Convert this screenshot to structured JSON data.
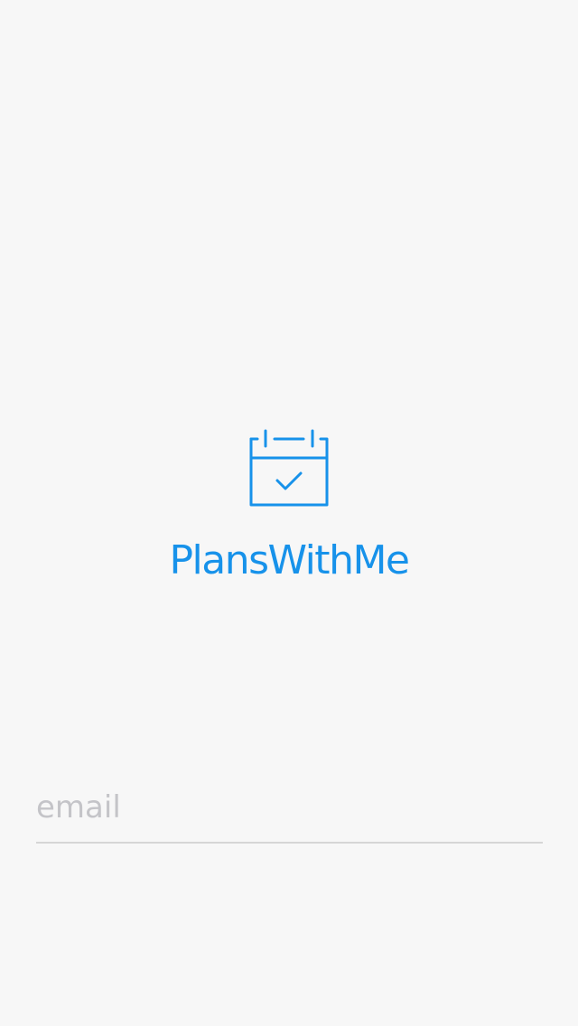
{
  "app": {
    "name": "PlansWithMe",
    "logo_icon": "calendar-check-icon",
    "accent_color": "#1792ea"
  },
  "login": {
    "email": {
      "value": "",
      "placeholder": "email"
    }
  },
  "colors": {
    "background": "#f7f7f7",
    "placeholder": "#c4c4c8",
    "underline": "#d6d6d6"
  }
}
